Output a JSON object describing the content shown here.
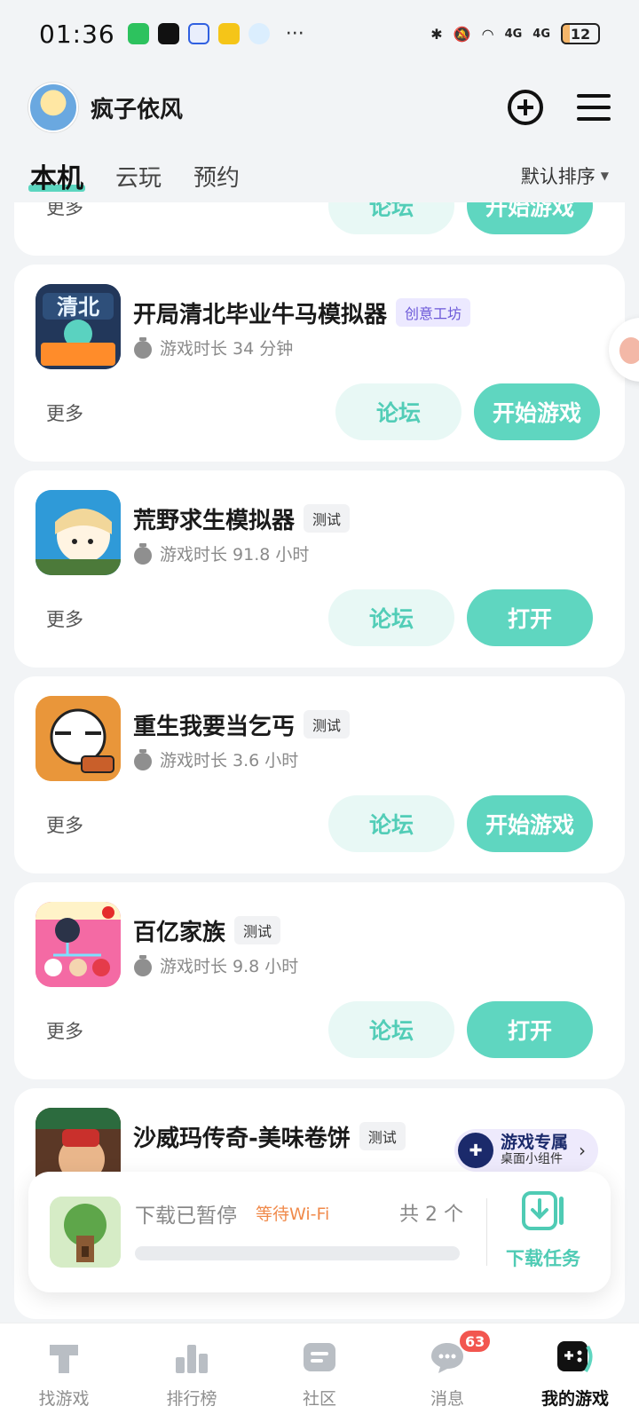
{
  "status_bar": {
    "time": "01:36",
    "more": "···",
    "signal_1": "4G",
    "signal_2": "4G",
    "battery": "12"
  },
  "header": {
    "username": "疯子依风",
    "add_icon": "plus-circle-icon",
    "menu_icon": "hamburger-menu-icon"
  },
  "tabs": [
    {
      "label": "本机",
      "active": true
    },
    {
      "label": "云玩",
      "active": false
    },
    {
      "label": "预约",
      "active": false
    }
  ],
  "sort": {
    "label": "默认排序",
    "icon": "caret-down-icon"
  },
  "partial_card": {
    "more_label": "更多",
    "forum_label": "论坛",
    "play_label": "开始游戏"
  },
  "games": [
    {
      "name": "开局清北毕业牛马模拟器",
      "tag": "创意工坊",
      "playtime": "游戏时长 34 分钟",
      "more_label": "更多",
      "forum_label": "论坛",
      "play_label": "开始游戏"
    },
    {
      "name": "荒野求生模拟器",
      "tag": "测试",
      "playtime": "游戏时长 91.8 小时",
      "more_label": "更多",
      "forum_label": "论坛",
      "play_label": "打开"
    },
    {
      "name": "重生我要当乞丐",
      "tag": "测试",
      "playtime": "游戏时长 3.6 小时",
      "more_label": "更多",
      "forum_label": "论坛",
      "play_label": "开始游戏"
    },
    {
      "name": "百亿家族",
      "tag": "测试",
      "playtime": "游戏时长 9.8 小时",
      "more_label": "更多",
      "forum_label": "论坛",
      "play_label": "打开"
    },
    {
      "name": "沙威玛传奇-美味卷饼",
      "tag": "测试"
    }
  ],
  "widget_chip": {
    "title": "游戏专属",
    "subtitle": "桌面小组件",
    "icon": "gamepad-icon"
  },
  "download": {
    "status": "下载已暂停",
    "waiting": "等待Wi-Fi",
    "count": "共 2 个",
    "progress": 0,
    "task_label": "下载任务",
    "task_icon": "download-task-icon"
  },
  "bottom_nav": [
    {
      "label": "找游戏",
      "icon": "find-game-icon",
      "active": false
    },
    {
      "label": "排行榜",
      "icon": "ranking-icon",
      "active": false
    },
    {
      "label": "社区",
      "icon": "community-icon",
      "active": false
    },
    {
      "label": "消息",
      "icon": "message-icon",
      "active": false,
      "badge": "63"
    },
    {
      "label": "我的游戏",
      "icon": "my-games-icon",
      "active": true
    }
  ],
  "colors": {
    "accent": "#5fd6c0",
    "accent_light": "#e8f8f5",
    "warning": "#f08a4b",
    "badge": "#f2564f"
  }
}
